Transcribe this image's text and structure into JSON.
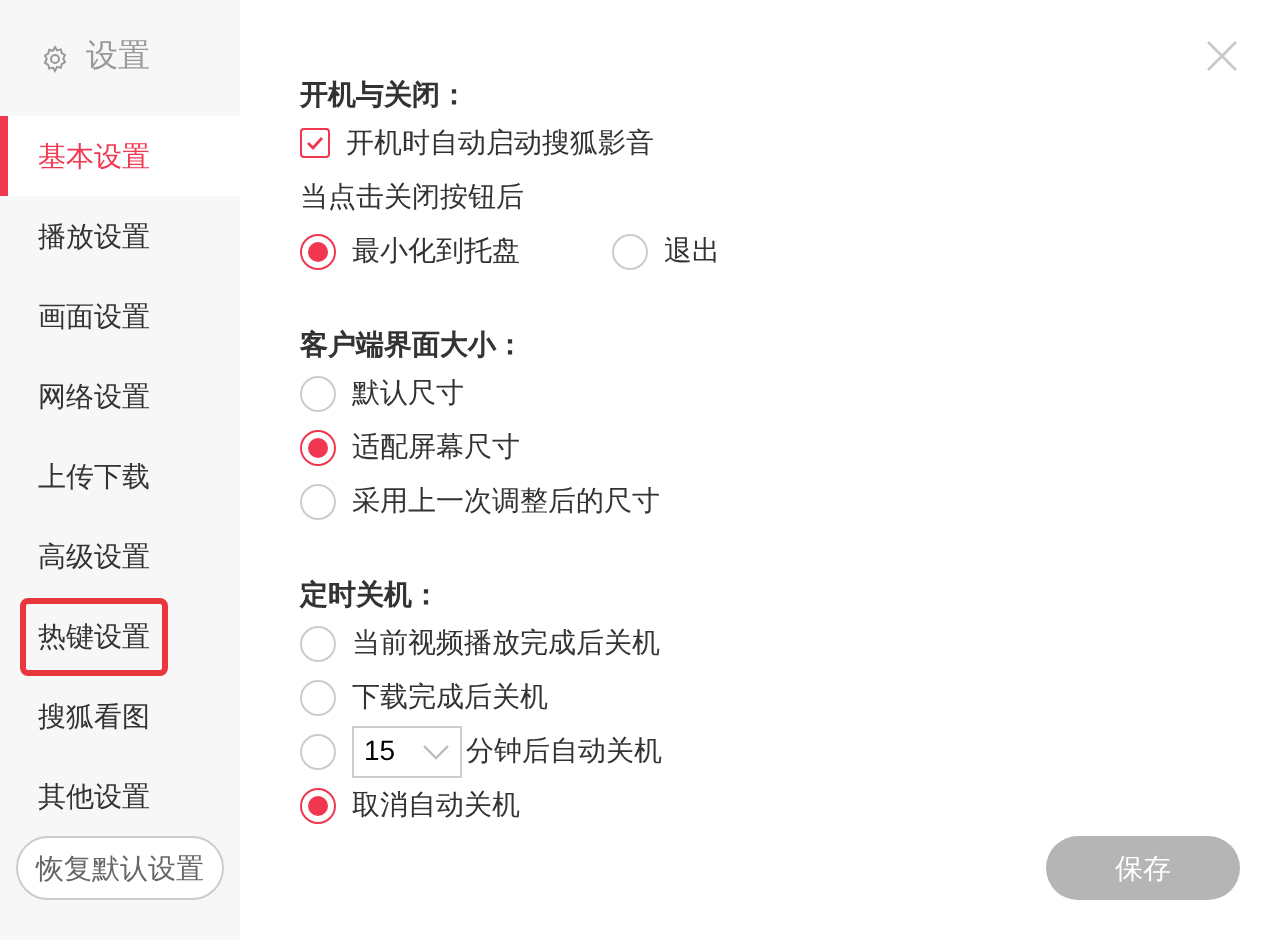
{
  "sidebar": {
    "title": "设置",
    "items": [
      {
        "label": "基本设置",
        "selected": true,
        "highlighted": false
      },
      {
        "label": "播放设置",
        "selected": false,
        "highlighted": false
      },
      {
        "label": "画面设置",
        "selected": false,
        "highlighted": false
      },
      {
        "label": "网络设置",
        "selected": false,
        "highlighted": false
      },
      {
        "label": "上传下载",
        "selected": false,
        "highlighted": false
      },
      {
        "label": "高级设置",
        "selected": false,
        "highlighted": false
      },
      {
        "label": "热键设置",
        "selected": false,
        "highlighted": true
      },
      {
        "label": "搜狐看图",
        "selected": false,
        "highlighted": false
      },
      {
        "label": "其他设置",
        "selected": false,
        "highlighted": false
      }
    ],
    "reset_button": "恢复默认设置"
  },
  "sections": [
    {
      "title": "开机与关闭：",
      "rows": [
        {
          "kind": "checkbox",
          "label": "开机时自动启动搜狐影音",
          "checked": true
        },
        {
          "kind": "text",
          "label": "当点击关闭按钮后"
        },
        {
          "kind": "radio_group",
          "options": [
            {
              "label": "最小化到托盘",
              "selected": true
            },
            {
              "label": "退出",
              "selected": false
            }
          ]
        }
      ]
    },
    {
      "title": "客户端界面大小：",
      "rows": [
        {
          "kind": "radio",
          "label": "默认尺寸",
          "selected": false
        },
        {
          "kind": "radio",
          "label": "适配屏幕尺寸",
          "selected": true
        },
        {
          "kind": "radio",
          "label": "采用上一次调整后的尺寸",
          "selected": false
        }
      ]
    },
    {
      "title": "定时关机：",
      "rows": [
        {
          "kind": "radio",
          "label": "当前视频播放完成后关机",
          "selected": false
        },
        {
          "kind": "radio",
          "label": "下载完成后关机",
          "selected": false
        },
        {
          "kind": "radio_select",
          "value": "15",
          "label": "分钟后自动关机",
          "selected": false
        },
        {
          "kind": "radio",
          "label": "取消自动关机",
          "selected": true
        }
      ]
    }
  ],
  "save_button": {
    "label": "保存",
    "disabled": true
  }
}
